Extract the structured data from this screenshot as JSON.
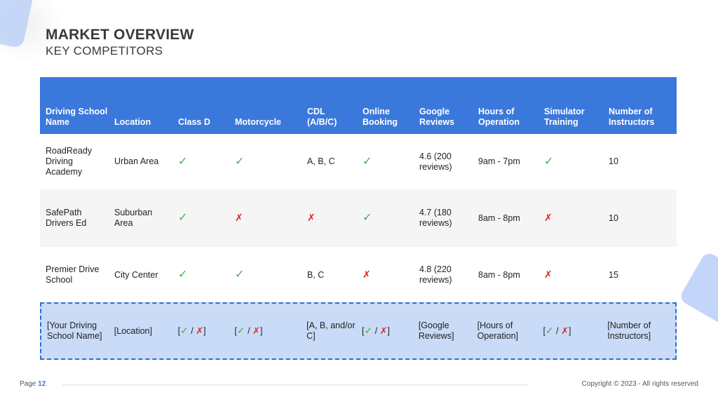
{
  "title": "MARKET OVERVIEW",
  "subtitle": "KEY COMPETITORS",
  "table": {
    "headers": [
      "Driving School Name",
      "Location",
      "Class D",
      "Motorcycle",
      "CDL (A/B/C)",
      "Online Booking",
      "Google Reviews",
      "Hours of Operation",
      "Simulator Training",
      "Number of Instructors"
    ],
    "rows": [
      [
        "RoadReady Driving Academy",
        "Urban Area",
        "yes",
        "yes",
        "A, B, C",
        "yes",
        "4.6 (200 reviews)",
        "9am - 7pm",
        "yes",
        "10"
      ],
      [
        "SafePath Drivers Ed",
        "Suburban Area",
        "yes",
        "no",
        "no",
        "yes",
        "4.7 (180 reviews)",
        "8am - 8pm",
        "no",
        "10"
      ],
      [
        "Premier Drive School",
        "City Center",
        "yes",
        "yes",
        "B, C",
        "no",
        "4.8 (220 reviews)",
        "8am - 8pm",
        "no",
        "15"
      ]
    ],
    "your_row": [
      "[Your Driving School Name]",
      "[Location]",
      "mix",
      "mix",
      "[A, B, and/or C]",
      "mix",
      "[Google Reviews]",
      "[Hours of Operation]",
      "mix",
      "[Number of Instructors]"
    ]
  },
  "symbols": {
    "yes": "✓",
    "no": "✗",
    "slash": " / ",
    "open": "[",
    "close": "]"
  },
  "colors": {
    "header_bg": "#3b78dc",
    "check": "#45b24a",
    "cross": "#e02424",
    "highlight_bg": "#c9dbf7",
    "highlight_border": "#2f6bd6"
  },
  "footer": {
    "page_label": "Page",
    "page_number": "12",
    "copyright": "Copyright © 2023 - All rights reserved"
  }
}
